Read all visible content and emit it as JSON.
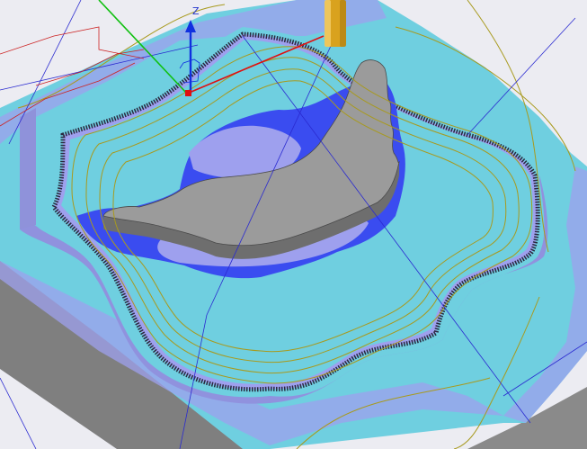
{
  "viewport": {
    "axis_label_z": "Z",
    "colors": {
      "background": "#ececf2",
      "stock_top": "#6fcfe0",
      "stock_side": "#8a8a8a",
      "pocket_floor": "#9ea0ee",
      "pocket_wall": "#8f92da",
      "machined_region": "#3a4cf0",
      "part": "#9b9b9b",
      "toolpath": "#a89a1e",
      "rapid_moves": "#cc2222",
      "link_moves": "#2a2ad0",
      "tool": "#d9a21e",
      "axis_x": "#e01010",
      "axis_y": "#10c010",
      "axis_z": "#1030e0"
    },
    "icons": {
      "tool": "end-mill-icon",
      "triad": "xyz-triad-icon"
    }
  }
}
